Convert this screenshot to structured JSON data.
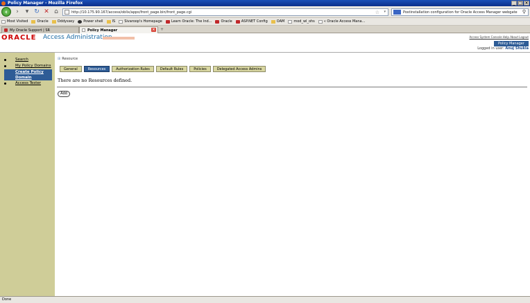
{
  "window": {
    "title": "Policy Manager - Mozilla Firefox"
  },
  "toolbar": {
    "url": "http://10.175.90.167/access/oblix/apps/front_page.bin/front_page.cgi",
    "search": "Postinstallation configuration for Oracle Access Manager webgate"
  },
  "bookmarks": [
    {
      "label": "Most Visited",
      "icon": "page"
    },
    {
      "label": "Oracle",
      "icon": "folder"
    },
    {
      "label": "Oddyssey",
      "icon": "folder"
    },
    {
      "label": "Power shell",
      "icon": "dark"
    },
    {
      "label": "IS",
      "icon": "folder"
    },
    {
      "label": "Sivaroop's Homepage",
      "icon": "page"
    },
    {
      "label": "Learn Oracle: The Ind...",
      "icon": "red"
    },
    {
      "label": "Oracle",
      "icon": "red"
    },
    {
      "label": "ASP.NET Config",
      "icon": "red"
    },
    {
      "label": "OAM",
      "icon": "folder"
    },
    {
      "label": "mod_wl_ohs",
      "icon": "page"
    },
    {
      "label": "« Oracle Access Mana...",
      "icon": "page"
    }
  ],
  "tabs": [
    {
      "label": "My Oracle Support | SR",
      "active": false
    },
    {
      "label": "Policy Manager",
      "active": true
    }
  ],
  "header": {
    "logo": "ORACLE",
    "app_title": "Access Administration",
    "links": "Access System Console Help About Logout",
    "badge": "Policy Manager",
    "logged_in_label": "Logged in user:",
    "user": "Anuj Shukla"
  },
  "sidebar": {
    "items": [
      {
        "label": "Search",
        "selected": false
      },
      {
        "label": "My Policy Domains",
        "selected": false
      },
      {
        "label": "Create Policy Domain",
        "selected": true
      },
      {
        "label": "Access Tester",
        "selected": false
      }
    ]
  },
  "main": {
    "breadcrumb": "Resource",
    "tabs": [
      "General",
      "Resources",
      "Authorization Rules",
      "Default Rules",
      "Policies",
      "Delegated Access Admins"
    ],
    "active_tab": "Resources",
    "message": "There are no Resources defined.",
    "add_label": "Add"
  },
  "status": {
    "text": "Done"
  }
}
